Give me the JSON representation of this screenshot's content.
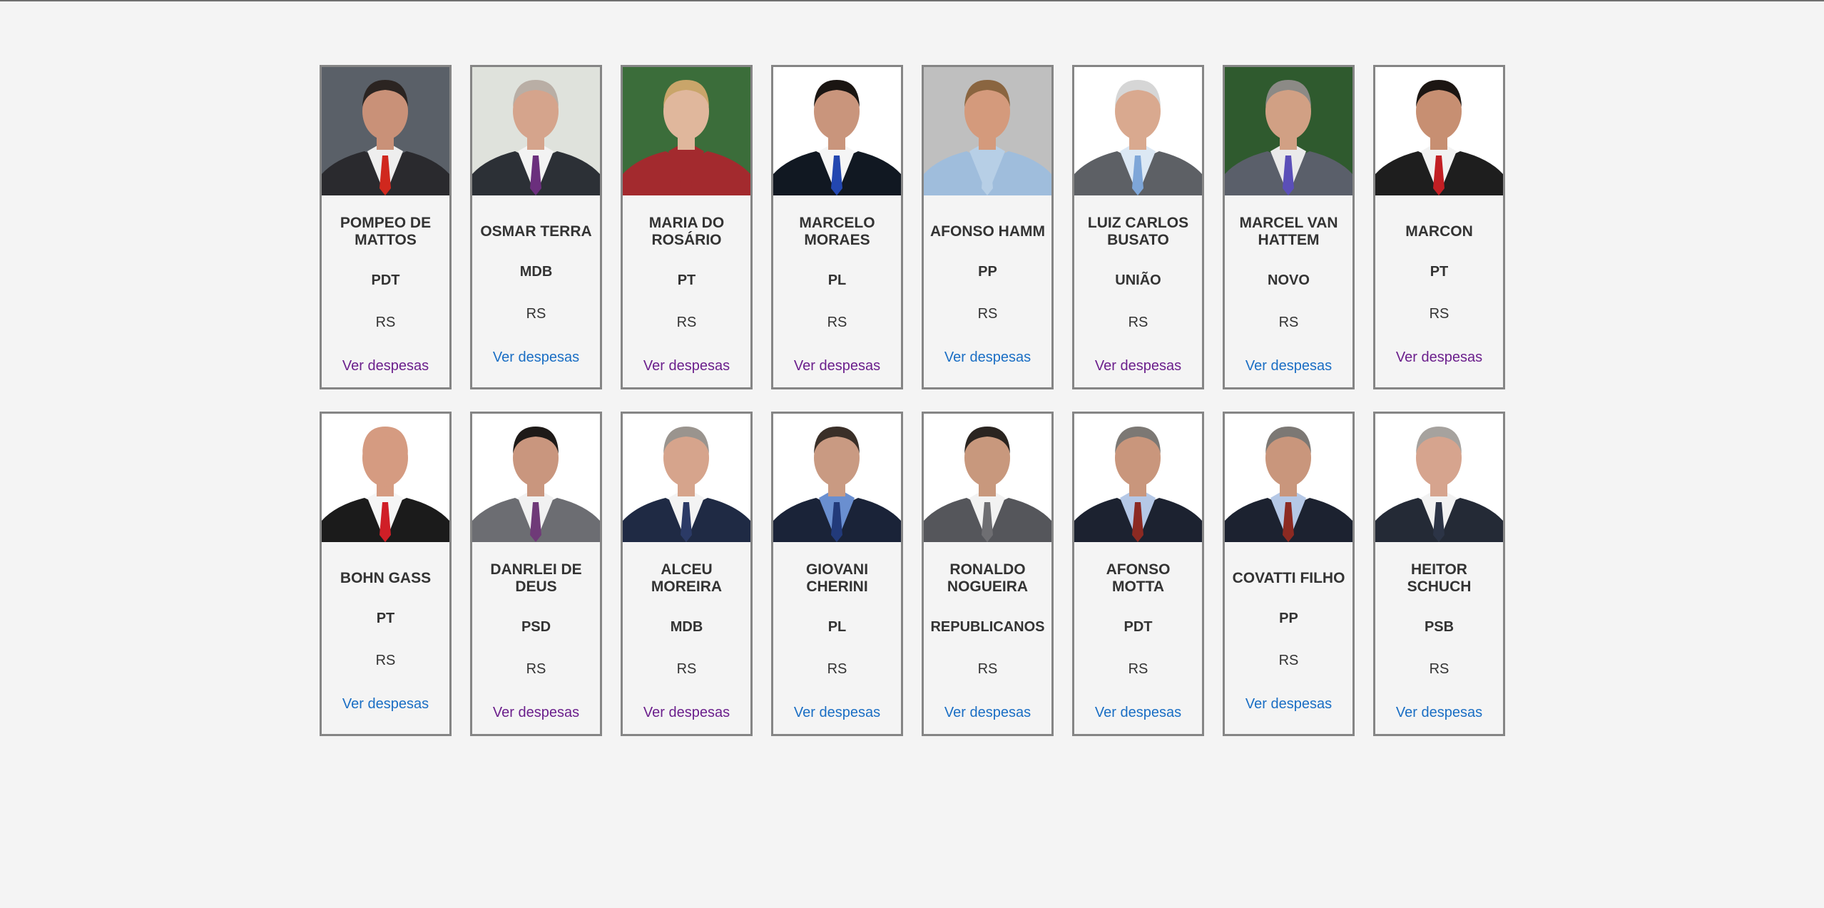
{
  "link_label": "Ver despesas",
  "link_colors": {
    "unvisited": "#1a6ec4",
    "visited": "#6b1f8c"
  },
  "deputies": [
    {
      "name": "POMPEO DE MATTOS",
      "party": "PDT",
      "state": "RS",
      "link_visited": true,
      "photo": {
        "bg": "#5a6068",
        "skin": "#c99178",
        "hair": "#2b2421",
        "suit": "#2a2a2e",
        "shirt": "#eeeeee",
        "tie": "#d0281e"
      }
    },
    {
      "name": "OSMAR TERRA",
      "party": "MDB",
      "state": "RS",
      "link_visited": false,
      "photo": {
        "bg": "#dfe2dc",
        "skin": "#d5a48c",
        "hair": "#b9aea5",
        "suit": "#2c3036",
        "shirt": "#f3f3f3",
        "tie": "#6b2f7d"
      }
    },
    {
      "name": "MARIA DO ROSÁRIO",
      "party": "PT",
      "state": "RS",
      "link_visited": true,
      "photo": {
        "bg": "#3b6d3a",
        "skin": "#e0b79c",
        "hair": "#c9a56a",
        "suit": "#a32a2e",
        "shirt": "#a32a2e",
        "tie": "#a32a2e"
      }
    },
    {
      "name": "MARCELO MORAES",
      "party": "PL",
      "state": "RS",
      "link_visited": true,
      "photo": {
        "bg": "#ffffff",
        "skin": "#c9957c",
        "hair": "#1a1512",
        "suit": "#111822",
        "shirt": "#f5f5f5",
        "tie": "#2347b0"
      }
    },
    {
      "name": "AFONSO HAMM",
      "party": "PP",
      "state": "RS",
      "link_visited": false,
      "photo": {
        "bg": "#bfbfbf",
        "skin": "#d49a7c",
        "hair": "#8a6540",
        "suit": "#9fbddc",
        "shirt": "#b7cfe6",
        "tie": "#b7cfe6"
      }
    },
    {
      "name": "LUIZ CARLOS BUSATO",
      "party": "UNIÃO",
      "state": "RS",
      "link_visited": true,
      "photo": {
        "bg": "#ffffff",
        "skin": "#d9a98f",
        "hair": "#d6d6d6",
        "suit": "#5d6065",
        "shirt": "#dce8f4",
        "tie": "#7ea6d8"
      }
    },
    {
      "name": "MARCEL VAN HATTEM",
      "party": "NOVO",
      "state": "RS",
      "link_visited": false,
      "photo": {
        "bg": "#2f5a2e",
        "skin": "#d1a084",
        "hair": "#8c8a86",
        "suit": "#5a5f6a",
        "shirt": "#eaeaea",
        "tie": "#5b4fb8"
      }
    },
    {
      "name": "MARCON",
      "party": "PT",
      "state": "RS",
      "link_visited": true,
      "photo": {
        "bg": "#ffffff",
        "skin": "#c78f72",
        "hair": "#1c1613",
        "suit": "#1e1e1e",
        "shirt": "#f2f2f2",
        "tie": "#c21f24"
      }
    },
    {
      "name": "BOHN GASS",
      "party": "PT",
      "state": "RS",
      "link_visited": false,
      "photo": {
        "bg": "#ffffff",
        "skin": "#d59b81",
        "hair": "#d59b81",
        "suit": "#1b1b1b",
        "shirt": "#f5f5f5",
        "tie": "#d01f27"
      }
    },
    {
      "name": "DANRLEI DE DEUS",
      "party": "PSD",
      "state": "RS",
      "link_visited": true,
      "photo": {
        "bg": "#ffffff",
        "skin": "#c9967e",
        "hair": "#1e1a18",
        "suit": "#6c6d72",
        "shirt": "#f1f1f1",
        "tie": "#6f3a78"
      }
    },
    {
      "name": "ALCEU MOREIRA",
      "party": "MDB",
      "state": "RS",
      "link_visited": true,
      "photo": {
        "bg": "#ffffff",
        "skin": "#d6a48c",
        "hair": "#9a948e",
        "suit": "#1f2a44",
        "shirt": "#f3f3f3",
        "tie": "#2b3a66"
      }
    },
    {
      "name": "GIOVANI CHERINI",
      "party": "PL",
      "state": "RS",
      "link_visited": false,
      "photo": {
        "bg": "#ffffff",
        "skin": "#c99a82",
        "hair": "#3a2f28",
        "suit": "#1a2338",
        "shirt": "#6a8fd0",
        "tie": "#223a7a"
      }
    },
    {
      "name": "RONALDO NOGUEIRA",
      "party": "REPUBLICANOS",
      "state": "RS",
      "link_visited": false,
      "photo": {
        "bg": "#ffffff",
        "skin": "#c8987d",
        "hair": "#2a2420",
        "suit": "#55565b",
        "shirt": "#f2f2f2",
        "tie": "#6e6e72"
      }
    },
    {
      "name": "AFONSO MOTTA",
      "party": "PDT",
      "state": "RS",
      "link_visited": false,
      "photo": {
        "bg": "#ffffff",
        "skin": "#c9967c",
        "hair": "#7c7874",
        "suit": "#1c2230",
        "shirt": "#b5c8e6",
        "tie": "#8c2a22"
      }
    },
    {
      "name": "COVATTI FILHO",
      "party": "PP",
      "state": "RS",
      "link_visited": false,
      "photo": {
        "bg": "#ffffff",
        "skin": "#c9967c",
        "hair": "#7c7874",
        "suit": "#1c2230",
        "shirt": "#b5c8e6",
        "tie": "#8c2a22"
      }
    },
    {
      "name": "HEITOR SCHUCH",
      "party": "PSB",
      "state": "RS",
      "link_visited": false,
      "photo": {
        "bg": "#ffffff",
        "skin": "#d6a48e",
        "hair": "#a6a29e",
        "suit": "#242a36",
        "shirt": "#f2f2f2",
        "tie": "#2c3446"
      }
    }
  ]
}
